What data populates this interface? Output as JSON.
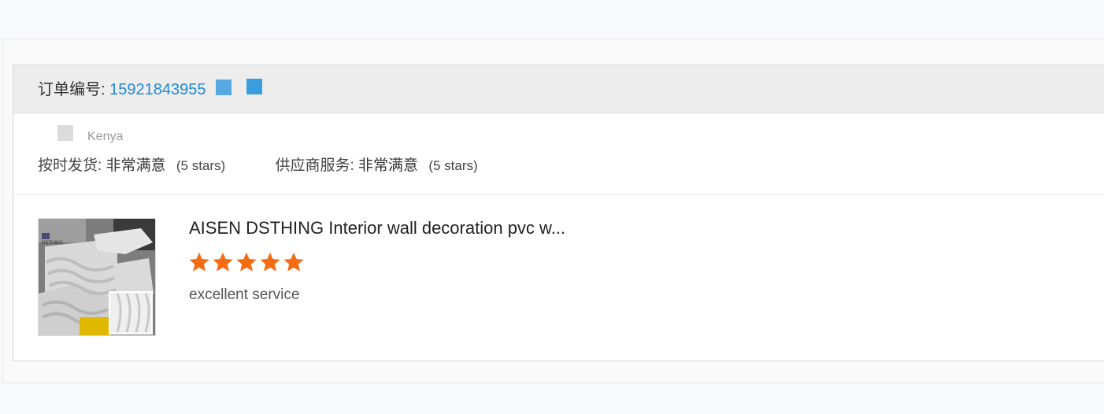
{
  "order": {
    "label": "订单编号:",
    "number": "15921843955"
  },
  "buyer": {
    "country": "Kenya"
  },
  "ratings": {
    "shipping": {
      "label": "按时发货:",
      "value": "非常满意",
      "stars_text": "(5 stars)"
    },
    "supplier_service": {
      "label": "供应商服务:",
      "value": "非常满意",
      "stars_text": "(5 stars)"
    }
  },
  "product": {
    "title": "AISEN DSTHING Interior wall decoration pvc w...",
    "thumbnail_brand": "DSTHING",
    "rating": 5,
    "rating_max": 5,
    "review": "excellent service"
  },
  "colors": {
    "link": "#1e88d6",
    "star": "#f56c14",
    "header_bg": "#ededed"
  },
  "icons": {
    "copy_a": "copy-icon",
    "copy_b": "copy-icon"
  }
}
